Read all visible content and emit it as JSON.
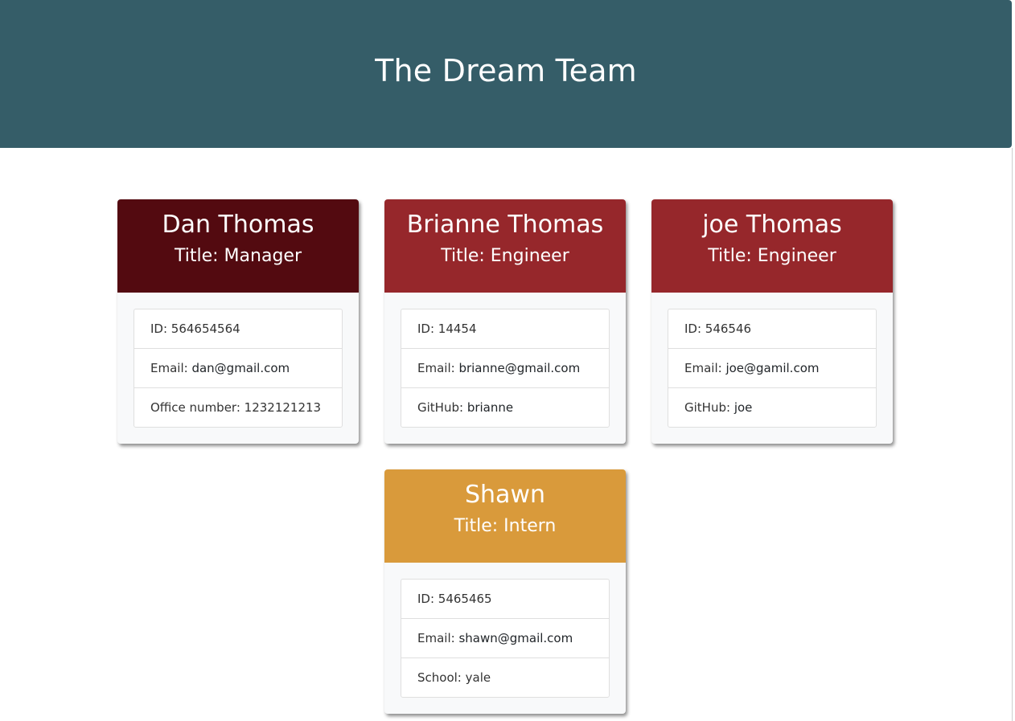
{
  "header": {
    "title": "The Dream Team"
  },
  "colors": {
    "header_bg": "#355d68",
    "manager": "#530a10",
    "engineer": "#96272b",
    "intern": "#d99a3b"
  },
  "cards": [
    {
      "name": "Dan Thomas",
      "title": "Title: Manager",
      "role": "manager",
      "id": "ID: 564654564",
      "email_label": "Email: ",
      "email": "dan@gmail.com",
      "extra": "Office number: 1232121213"
    },
    {
      "name": "Brianne Thomas",
      "title": "Title: Engineer",
      "role": "engineer",
      "id": "ID: 14454",
      "email_label": "Email: ",
      "email": "brianne@gmail.com",
      "extra_label": "GitHub: ",
      "extra_link": "brianne"
    },
    {
      "name": "joe Thomas",
      "title": "Title: Engineer",
      "role": "engineer",
      "id": "ID: 546546",
      "email_label": "Email: ",
      "email": "joe@gamil.com",
      "extra_label": "GitHub: ",
      "extra_link": "joe"
    },
    {
      "name": "Shawn",
      "title": "Title: Intern",
      "role": "intern",
      "id": "ID: 5465465",
      "email_label": "Email: ",
      "email": "shawn@gmail.com",
      "extra": "School: yale"
    }
  ]
}
